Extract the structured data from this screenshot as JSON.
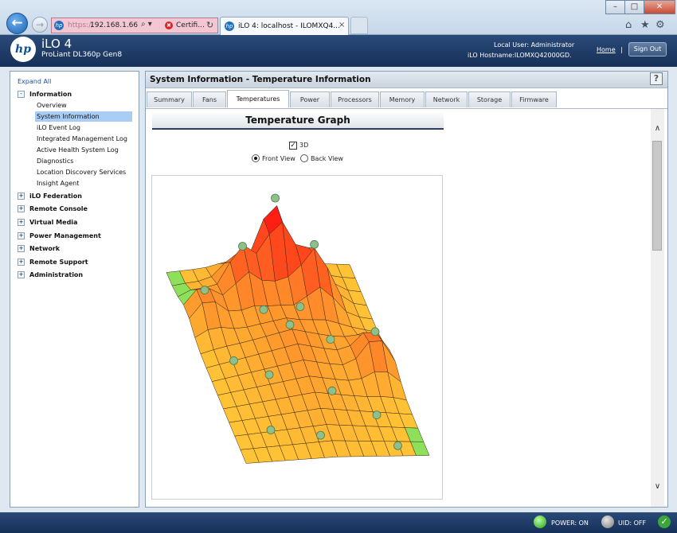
{
  "browser": {
    "address_proto": "https://",
    "address_host": "192.168.1.66",
    "cert_label": "Certifi...",
    "tab_title": "iLO 4: localhost - ILOMXQ4...",
    "tab_close": "×",
    "icons": [
      "back-icon",
      "forward-icon",
      "search-icon",
      "error-icon",
      "reload-icon",
      "home-icon",
      "favorites-icon",
      "gear-icon"
    ]
  },
  "header": {
    "logo": "hp",
    "product": "iLO 4",
    "model": "ProLiant DL360p Gen8",
    "local_user": "Local User:  Administrator",
    "hostname": "iLO Hostname:ILOMXQ42000GD.",
    "home_link": "Home",
    "separator": "|",
    "sign_out": "Sign Out"
  },
  "sidebar": {
    "expand_all": "Expand All",
    "sections": [
      {
        "toggle": "-",
        "label": "Information"
      },
      {
        "toggle": "+",
        "label": "iLO Federation"
      },
      {
        "toggle": "+",
        "label": "Remote Console"
      },
      {
        "toggle": "+",
        "label": "Virtual Media"
      },
      {
        "toggle": "+",
        "label": "Power Management"
      },
      {
        "toggle": "+",
        "label": "Network"
      },
      {
        "toggle": "+",
        "label": "Remote Support"
      },
      {
        "toggle": "+",
        "label": "Administration"
      }
    ],
    "information_items": [
      "Overview",
      "System Information",
      "iLO Event Log",
      "Integrated Management Log",
      "Active Health System Log",
      "Diagnostics",
      "Location Discovery Services",
      "Insight Agent"
    ],
    "selected_item": "System Information"
  },
  "main": {
    "title": "System Information - Temperature Information",
    "help": "?",
    "tabs": [
      "Summary",
      "Fans",
      "Temperatures",
      "Power",
      "Processors",
      "Memory",
      "Network",
      "Storage",
      "Firmware"
    ],
    "active_tab": "Temperatures",
    "graph": {
      "title": "Temperature Graph",
      "option_3d": "3D",
      "option_3d_checked": true,
      "front_view": "Front View",
      "back_view": "Back View",
      "selected_view": "Front View"
    }
  },
  "status_bar": {
    "power": "POWER: ON",
    "uid": "UID: OFF",
    "colors": {
      "power_led": "#1f9b1f",
      "uid_led": "#7a7a7a"
    }
  },
  "colors": {
    "header_bg": "#1f3d69",
    "tab_active": "#ffffff",
    "sidebar_selected": "#aacdf5"
  }
}
